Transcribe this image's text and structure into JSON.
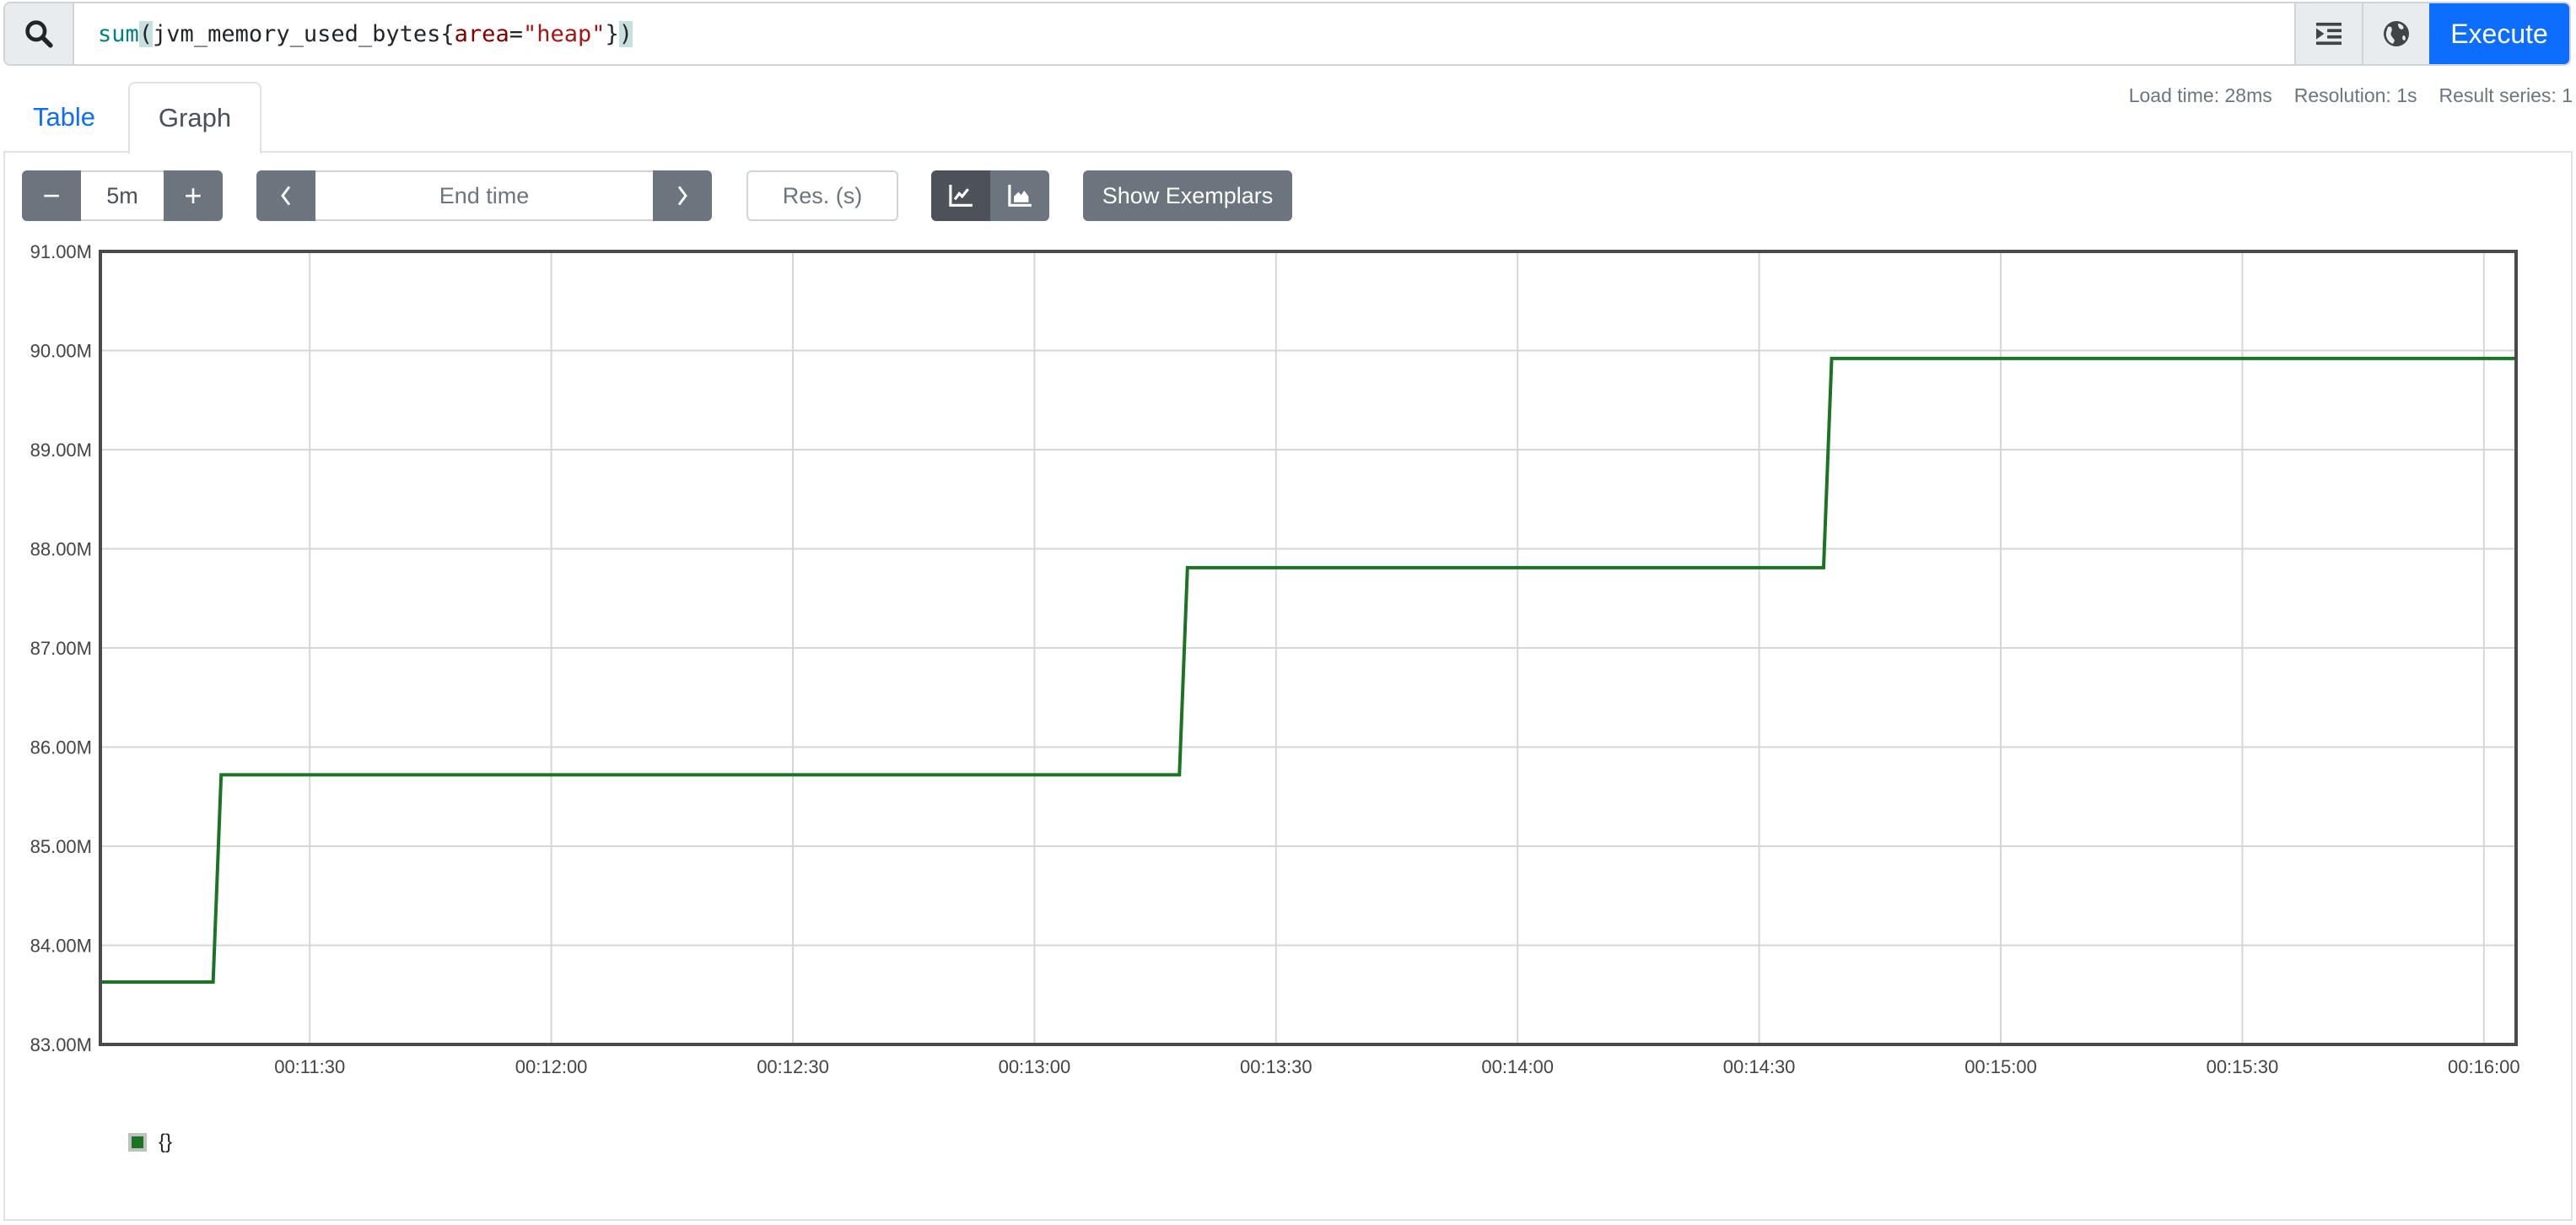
{
  "query_bar": {
    "search_icon": "search-icon",
    "expression_tokens": [
      {
        "text": "sum",
        "type": "fn"
      },
      {
        "text": "(",
        "type": "paren"
      },
      {
        "text": "jvm_memory_used_bytes{",
        "type": "plain"
      },
      {
        "text": "area",
        "type": "label"
      },
      {
        "text": "=",
        "type": "plain"
      },
      {
        "text": "\"heap\"",
        "type": "str"
      },
      {
        "text": "}",
        "type": "plain"
      },
      {
        "text": ")",
        "type": "paren"
      }
    ],
    "format_icon": "indent-format-icon",
    "metrics_explorer_icon": "globe-icon",
    "execute_label": "Execute"
  },
  "stats": {
    "load_time": "Load time: 28ms",
    "resolution": "Resolution: 1s",
    "result_series": "Result series: 1"
  },
  "tabs": [
    {
      "label": "Table",
      "active": false
    },
    {
      "label": "Graph",
      "active": true
    }
  ],
  "controls": {
    "range_decrease": "−",
    "range_value": "5m",
    "range_increase": "+",
    "time_prev": "‹",
    "end_time_placeholder": "End time",
    "time_next": "›",
    "resolution_placeholder": "Res. (s)",
    "chart_type_selected": "line",
    "show_exemplars_label": "Show Exemplars"
  },
  "colors": {
    "accent": "#0d6efd",
    "series": "#1a7424",
    "button_dark": "#6c757d"
  },
  "chart_data": {
    "type": "line",
    "title": "",
    "xlabel": "",
    "ylabel": "",
    "ylim": [
      83000000,
      91000000
    ],
    "xlim": [
      "00:11:04",
      "00:16:04"
    ],
    "y_ticks": [
      "83.00M",
      "84.00M",
      "85.00M",
      "86.00M",
      "87.00M",
      "88.00M",
      "89.00M",
      "90.00M",
      "91.00M"
    ],
    "y_tick_values": [
      83000000,
      84000000,
      85000000,
      86000000,
      87000000,
      88000000,
      89000000,
      90000000,
      91000000
    ],
    "x_ticks": [
      "00:11:30",
      "00:12:00",
      "00:12:30",
      "00:13:00",
      "00:13:30",
      "00:14:00",
      "00:14:30",
      "00:15:00",
      "00:15:30",
      "00:16:00"
    ],
    "grid": true,
    "legend": "bottom-left",
    "series": [
      {
        "name": "{}",
        "color": "#1a7424",
        "points": [
          {
            "t": "00:11:04",
            "v": 83630000
          },
          {
            "t": "00:11:18",
            "v": 83630000
          },
          {
            "t": "00:11:19",
            "v": 85720000
          },
          {
            "t": "00:13:18",
            "v": 85720000
          },
          {
            "t": "00:13:19",
            "v": 87810000
          },
          {
            "t": "00:14:38",
            "v": 87810000
          },
          {
            "t": "00:14:39",
            "v": 89920000
          },
          {
            "t": "00:16:04",
            "v": 89920000
          }
        ]
      }
    ]
  }
}
